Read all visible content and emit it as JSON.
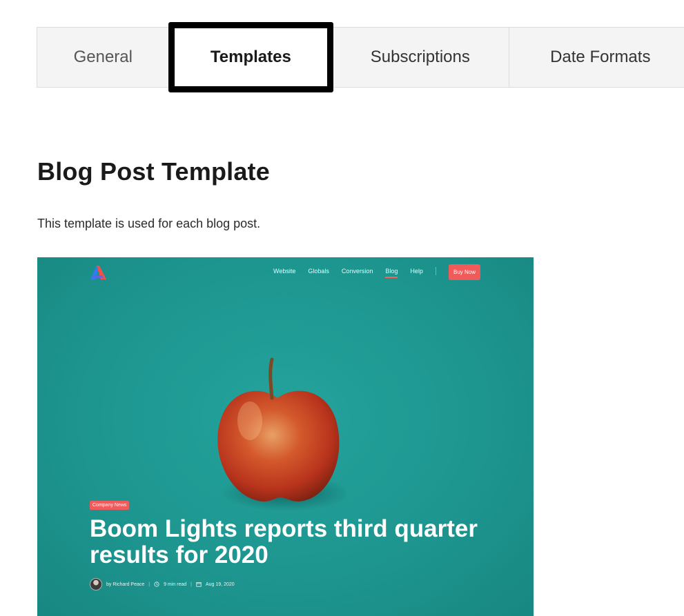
{
  "tabs": [
    {
      "label": "General",
      "active": false
    },
    {
      "label": "Templates",
      "active": true
    },
    {
      "label": "Subscriptions",
      "active": false
    },
    {
      "label": "Date Formats",
      "active": false
    }
  ],
  "section": {
    "title": "Blog Post Template",
    "description": "This template is used for each blog post."
  },
  "preview": {
    "nav": [
      "Website",
      "Globals",
      "Conversion",
      "Blog",
      "Help"
    ],
    "active_nav": "Blog",
    "cta_label": "Buy Now",
    "tag": "Company News",
    "headline": "Boom Lights reports third quarter results for 2020",
    "author": "by Richard Peace",
    "read_time": "9 min read",
    "date": "Aug 19, 2020",
    "colors": {
      "background": "#1e9690",
      "accent": "#f25a5a",
      "active_tab_outline": "#000000"
    }
  }
}
